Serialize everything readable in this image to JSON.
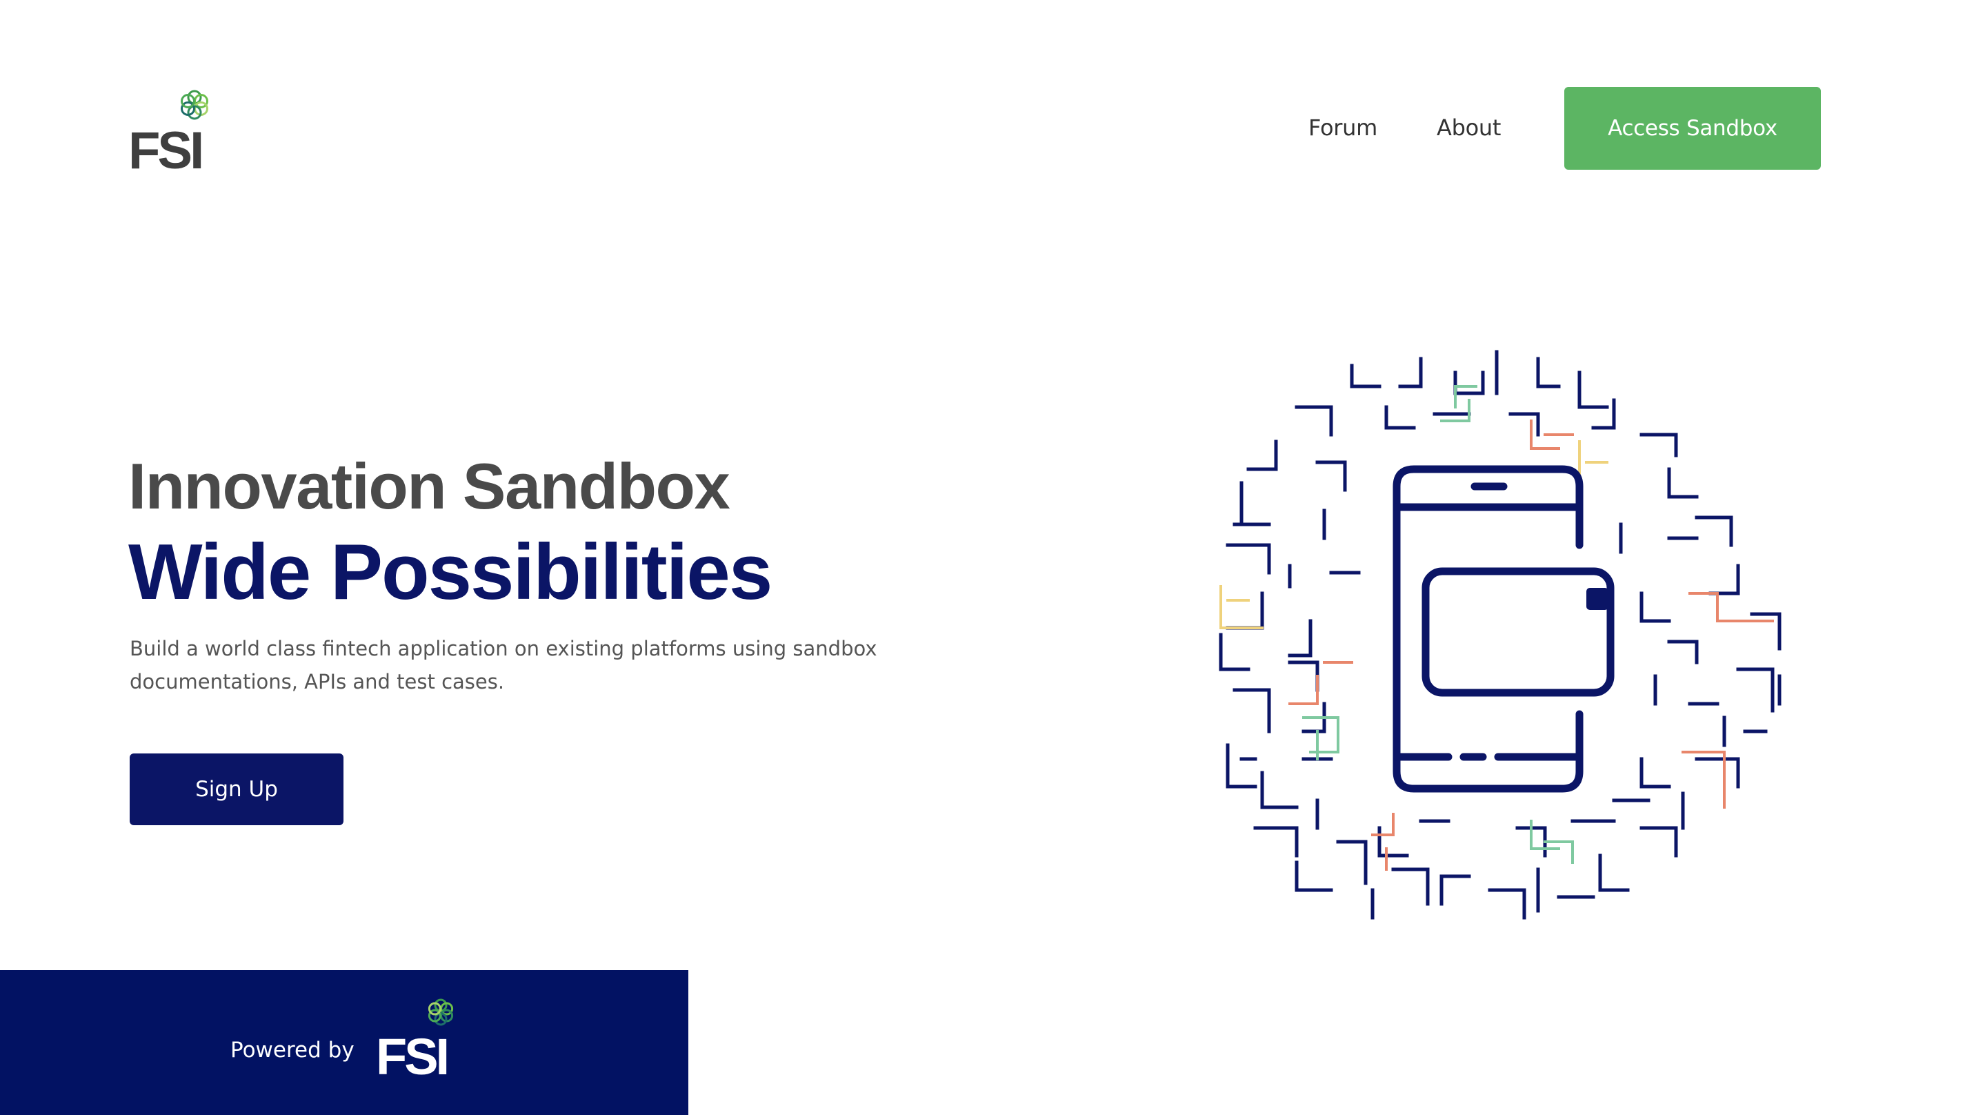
{
  "header": {
    "logo_text": "FSI",
    "nav": {
      "forum_label": "Forum",
      "about_label": "About",
      "access_label": "Access Sandbox"
    }
  },
  "hero": {
    "title": "Innovation Sandbox",
    "subtitle": "Wide Possibilities",
    "description": "Build a world class fintech application on existing platforms using sandbox documentations, APIs and test cases.",
    "signup_label": "Sign Up",
    "illustration_icon": "phone-card-maze-icon"
  },
  "footer": {
    "powered_by_label": "Powered by",
    "logo_text": "FSI"
  },
  "colors": {
    "primary_navy": "#0b1566",
    "footer_navy": "#021263",
    "accent_green": "#5cb563",
    "heading_gray": "#4a4a4a",
    "maze_coral": "#e8866b",
    "maze_mint": "#7fc9a0",
    "maze_yellow": "#efd27c"
  }
}
